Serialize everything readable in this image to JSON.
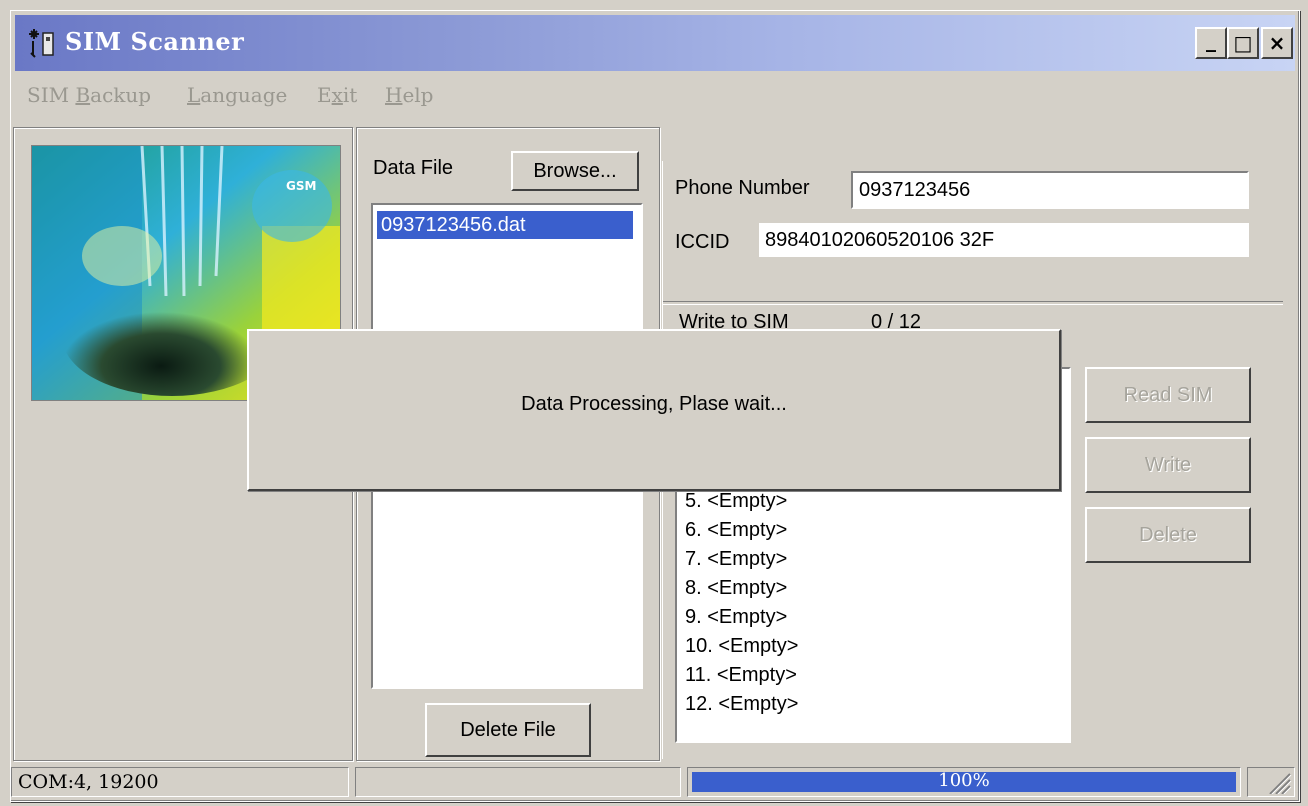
{
  "window": {
    "title": "SIM Scanner",
    "controls": {
      "minimize": "_",
      "maximize": "□",
      "close": "×"
    }
  },
  "menu": {
    "items": [
      {
        "pre": "SIM ",
        "key": "B",
        "post": "ackup"
      },
      {
        "pre": "",
        "key": "L",
        "post": "anguage"
      },
      {
        "pre": "E",
        "key": "x",
        "post": "it"
      },
      {
        "pre": "",
        "key": "H",
        "post": "elp"
      }
    ]
  },
  "data_file": {
    "label": "Data File",
    "browse_label": "Browse...",
    "files": [
      "0937123456.dat"
    ],
    "selected_index": 0,
    "delete_label": "Delete File"
  },
  "sim_info": {
    "phone_label": "Phone Number",
    "phone_value": "0937123456",
    "iccid_label": "ICCID",
    "iccid_value": "89840102060520106 32F"
  },
  "write_section": {
    "label": "Write to SIM",
    "count": "0 / 12",
    "entries": [
      "5. <Empty>",
      "6. <Empty>",
      "7. <Empty>",
      "8. <Empty>",
      "9. <Empty>",
      "10. <Empty>",
      "11. <Empty>",
      "12. <Empty>"
    ]
  },
  "actions": {
    "read_label": "Read SIM",
    "write_label": "Write",
    "delete_label": "Delete"
  },
  "dialog": {
    "message": "Data Processing,  Plase wait..."
  },
  "status": {
    "port": "COM:4, 19200",
    "progress_text": "100%",
    "progress_value": 1.0
  },
  "colors": {
    "selection": "#3a5fcd",
    "face": "#d4d0c8"
  },
  "icons": [
    "app-icon",
    "minimize-icon",
    "maximize-icon",
    "close-icon",
    "resize-grip-icon"
  ]
}
